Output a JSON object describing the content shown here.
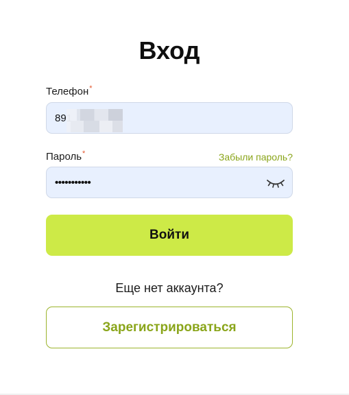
{
  "title": "Вход",
  "phone": {
    "label": "Телефон",
    "required_mark": "*",
    "value": "891"
  },
  "password": {
    "label": "Пароль",
    "required_mark": "*",
    "value": "•••••••••••",
    "forgot_link": "Забыли пароль?",
    "toggle_icon": "eye-closed-icon"
  },
  "login_button": "Войти",
  "no_account_text": "Еще нет аккаунта?",
  "register_button": "Зарегистрироваться",
  "colors": {
    "accent": "#cdea47",
    "link": "#8aa51a",
    "required": "#e4572e",
    "field_bg": "#e8f0fe"
  }
}
